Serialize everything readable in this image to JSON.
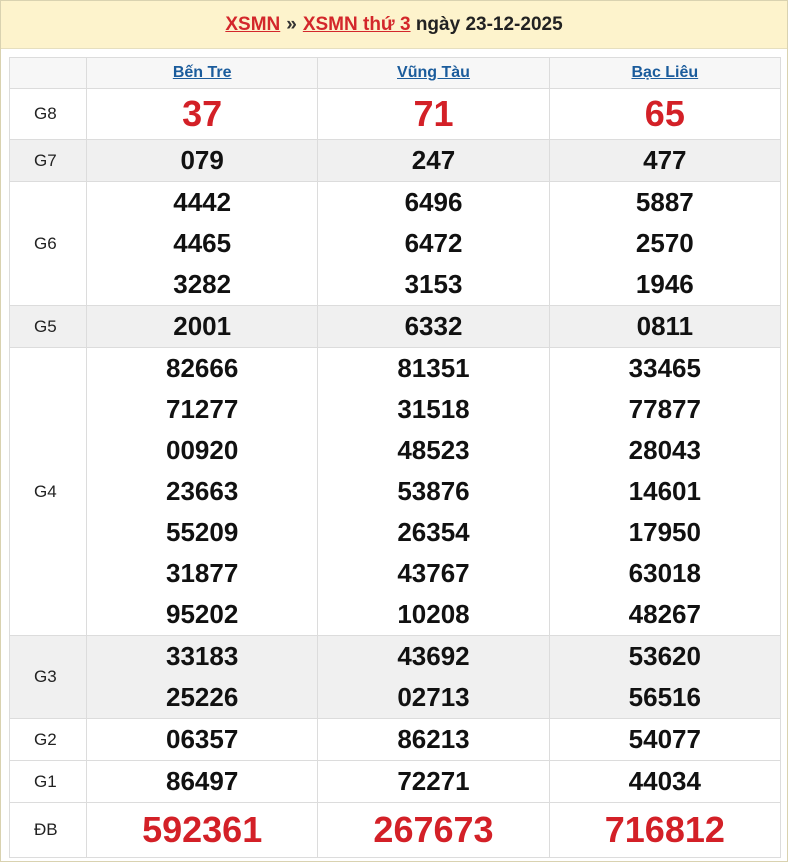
{
  "header": {
    "link1": "XSMN",
    "separator": "»",
    "link2": "XSMN thứ 3",
    "date_text": "ngày 23-12-2025"
  },
  "provinces": [
    "Bến Tre",
    "Vũng Tàu",
    "Bạc Liêu"
  ],
  "prizes": [
    {
      "label": "G8",
      "style": "big",
      "alt": false,
      "values": [
        [
          "37"
        ],
        [
          "71"
        ],
        [
          "65"
        ]
      ]
    },
    {
      "label": "G7",
      "style": "num",
      "alt": true,
      "values": [
        [
          "079"
        ],
        [
          "247"
        ],
        [
          "477"
        ]
      ]
    },
    {
      "label": "G6",
      "style": "num",
      "alt": false,
      "values": [
        [
          "4442",
          "4465",
          "3282"
        ],
        [
          "6496",
          "6472",
          "3153"
        ],
        [
          "5887",
          "2570",
          "1946"
        ]
      ]
    },
    {
      "label": "G5",
      "style": "num",
      "alt": true,
      "values": [
        [
          "2001"
        ],
        [
          "6332"
        ],
        [
          "0811"
        ]
      ]
    },
    {
      "label": "G4",
      "style": "num",
      "alt": false,
      "values": [
        [
          "82666",
          "71277",
          "00920",
          "23663",
          "55209",
          "31877",
          "95202"
        ],
        [
          "81351",
          "31518",
          "48523",
          "53876",
          "26354",
          "43767",
          "10208"
        ],
        [
          "33465",
          "77877",
          "28043",
          "14601",
          "17950",
          "63018",
          "48267"
        ]
      ]
    },
    {
      "label": "G3",
      "style": "num",
      "alt": true,
      "values": [
        [
          "33183",
          "25226"
        ],
        [
          "43692",
          "02713"
        ],
        [
          "53620",
          "56516"
        ]
      ]
    },
    {
      "label": "G2",
      "style": "num",
      "alt": false,
      "values": [
        [
          "06357"
        ],
        [
          "86213"
        ],
        [
          "54077"
        ]
      ]
    },
    {
      "label": "G1",
      "style": "num",
      "alt": false,
      "values": [
        [
          "86497"
        ],
        [
          "72271"
        ],
        [
          "44034"
        ]
      ]
    },
    {
      "label": "ĐB",
      "style": "db",
      "alt": false,
      "values": [
        [
          "592361"
        ],
        [
          "267673"
        ],
        [
          "716812"
        ]
      ]
    }
  ]
}
